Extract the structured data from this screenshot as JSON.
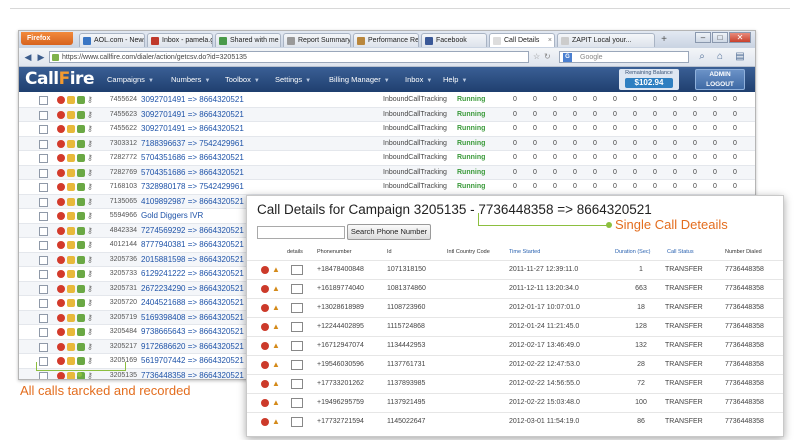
{
  "browser": {
    "firefox_label": "Firefox",
    "tabs": [
      {
        "label": "AOL.com - News...",
        "color": "#3a76c4"
      },
      {
        "label": "Inbox - pamela.g...",
        "color": "#c0392b"
      },
      {
        "label": "Shared with me -...",
        "color": "#4a9a4a"
      },
      {
        "label": "Report Summary",
        "color": "#999999"
      },
      {
        "label": "Performance Rep...",
        "color": "#b9873d"
      },
      {
        "label": "Facebook",
        "color": "#3b5998"
      },
      {
        "label": "Call Details",
        "color": "#dddddd",
        "active": true
      },
      {
        "label": "ZAPIT Local your...",
        "color": "#cccccc"
      }
    ],
    "new_tab": "+",
    "url": "https://www.callfire.com/dialer/action/getcsv.do?id=3205135",
    "search_placeholder": "Google",
    "search_engine_glyph": "G"
  },
  "app": {
    "logo_a": "Call",
    "logo_o": "F",
    "logo_b": "ire",
    "menus": [
      "Campaigns",
      "Numbers",
      "Toolbox",
      "Settings",
      "Billing Manager",
      "Inbox",
      "Help"
    ],
    "balance_label": "Remaining Balance",
    "balance_value": "$102.94",
    "admin_label": "ADMIN",
    "logout_label": "LOGOUT"
  },
  "calls": [
    {
      "id": "7455624",
      "route": "3092701491 => 8664320521",
      "type": "InboundCallTracking",
      "status": "Running",
      "nums": [
        "0",
        "0",
        "0",
        "0",
        "0",
        "0",
        "0",
        "0",
        "0",
        "0",
        "0",
        "0"
      ]
    },
    {
      "id": "7455623",
      "route": "3092701491 => 8664320521",
      "type": "InboundCallTracking",
      "status": "Running",
      "nums": [
        "0",
        "0",
        "0",
        "0",
        "0",
        "0",
        "0",
        "0",
        "0",
        "0",
        "0",
        "0"
      ]
    },
    {
      "id": "7455622",
      "route": "3092701491 => 8664320521",
      "type": "InboundCallTracking",
      "status": "Running",
      "nums": [
        "0",
        "0",
        "0",
        "0",
        "0",
        "0",
        "0",
        "0",
        "0",
        "0",
        "0",
        "0"
      ]
    },
    {
      "id": "7303312",
      "route": "7188396637 => 7542429961",
      "type": "InboundCallTracking",
      "status": "Running",
      "nums": [
        "0",
        "0",
        "0",
        "0",
        "0",
        "0",
        "0",
        "0",
        "0",
        "0",
        "0",
        "0"
      ]
    },
    {
      "id": "7282772",
      "route": "5704351686 => 8664320521",
      "type": "InboundCallTracking",
      "status": "Running",
      "nums": [
        "0",
        "0",
        "0",
        "0",
        "0",
        "0",
        "0",
        "0",
        "0",
        "0",
        "0",
        "0"
      ]
    },
    {
      "id": "7282769",
      "route": "5704351686 => 8664320521",
      "type": "InboundCallTracking",
      "status": "Running",
      "nums": [
        "0",
        "0",
        "0",
        "0",
        "0",
        "0",
        "0",
        "0",
        "0",
        "0",
        "0",
        "0"
      ]
    },
    {
      "id": "7168103",
      "route": "7328980178 => 7542429961",
      "type": "InboundCallTracking",
      "status": "Running",
      "nums": [
        "0",
        "0",
        "0",
        "0",
        "0",
        "0",
        "0",
        "0",
        "0",
        "0",
        "0",
        "0"
      ]
    },
    {
      "id": "7135065",
      "route": "4109892987 => 8664320521",
      "type": "",
      "status": "",
      "nums": []
    },
    {
      "id": "5594966",
      "route": "Gold Diggers IVR",
      "type": "",
      "status": "",
      "nums": []
    },
    {
      "id": "4842334",
      "route": "7274569292 => 8664320521",
      "type": "",
      "status": "",
      "nums": []
    },
    {
      "id": "4012144",
      "route": "8777940381 => 8664320521",
      "type": "",
      "status": "",
      "nums": []
    },
    {
      "id": "3205736",
      "route": "2015881598 => 8664320521",
      "type": "",
      "status": "",
      "nums": []
    },
    {
      "id": "3205733",
      "route": "6129241222 => 8664320521",
      "type": "",
      "status": "",
      "nums": []
    },
    {
      "id": "3205731",
      "route": "2672234290 => 8664320521",
      "type": "",
      "status": "",
      "nums": []
    },
    {
      "id": "3205720",
      "route": "2404521688 => 8664320521",
      "type": "",
      "status": "",
      "nums": []
    },
    {
      "id": "3205719",
      "route": "5169398408 => 8664320521",
      "type": "",
      "status": "",
      "nums": []
    },
    {
      "id": "3205484",
      "route": "9738665643 => 8664320521",
      "type": "",
      "status": "",
      "nums": []
    },
    {
      "id": "3205217",
      "route": "9172686620 => 8664320521",
      "type": "",
      "status": "",
      "nums": []
    },
    {
      "id": "3205169",
      "route": "5619707442 => 8664320521",
      "type": "",
      "status": "",
      "nums": []
    },
    {
      "id": "3205135",
      "route": "7736448358 => 8664320521",
      "type": "",
      "status": "",
      "nums": []
    }
  ],
  "detail": {
    "title": "Call Details for Campaign 3205135 - 7736448358 => 8664320521",
    "search_button": "Search Phone Number",
    "headers": {
      "details": "details",
      "phone": "Phonenumber",
      "id": "Id",
      "country": "Intl Country Code",
      "time": "Time Started",
      "duration": "Duration (Sec)",
      "status": "Call Status",
      "dialed": "Number Dialed"
    },
    "rows": [
      {
        "phone": "+18478400848",
        "id": "1071318150",
        "time": "2011-11-27 12:39:11.0",
        "duration": "1",
        "status": "TRANSFER",
        "dialed": "7736448358"
      },
      {
        "phone": "+16189774040",
        "id": "1081374860",
        "time": "2011-12-11 13:20:34.0",
        "duration": "663",
        "status": "TRANSFER",
        "dialed": "7736448358"
      },
      {
        "phone": "+13028618989",
        "id": "1108723960",
        "time": "2012-01-17 10:07:01.0",
        "duration": "18",
        "status": "TRANSFER",
        "dialed": "7736448358"
      },
      {
        "phone": "+12244402895",
        "id": "1115724868",
        "time": "2012-01-24 11:21:45.0",
        "duration": "128",
        "status": "TRANSFER",
        "dialed": "7736448358"
      },
      {
        "phone": "+16712947074",
        "id": "1134442953",
        "time": "2012-02-17 13:46:49.0",
        "duration": "132",
        "status": "TRANSFER",
        "dialed": "7736448358"
      },
      {
        "phone": "+19546030596",
        "id": "1137761731",
        "time": "2012-02-22 12:47:53.0",
        "duration": "28",
        "status": "TRANSFER",
        "dialed": "7736448358"
      },
      {
        "phone": "+17733201262",
        "id": "1137893985",
        "time": "2012-02-22 14:56:55.0",
        "duration": "72",
        "status": "TRANSFER",
        "dialed": "7736448358"
      },
      {
        "phone": "+19496295759",
        "id": "1137921495",
        "time": "2012-02-22 15:03:48.0",
        "duration": "100",
        "status": "TRANSFER",
        "dialed": "7736448358"
      },
      {
        "phone": "+17732721594",
        "id": "1145022647",
        "time": "2012-03-01 11:54:19.0",
        "duration": "86",
        "status": "TRANSFER",
        "dialed": "7736448358"
      }
    ]
  },
  "callouts": {
    "single": "Single Call Deteails",
    "all": "All calls tarcked and recorded"
  },
  "colors": {
    "accent": "#e36d1e",
    "connector": "#8cbf3f",
    "link": "#1d52a8",
    "running": "#3a9a3a",
    "appbar": "#1f3f6f"
  }
}
